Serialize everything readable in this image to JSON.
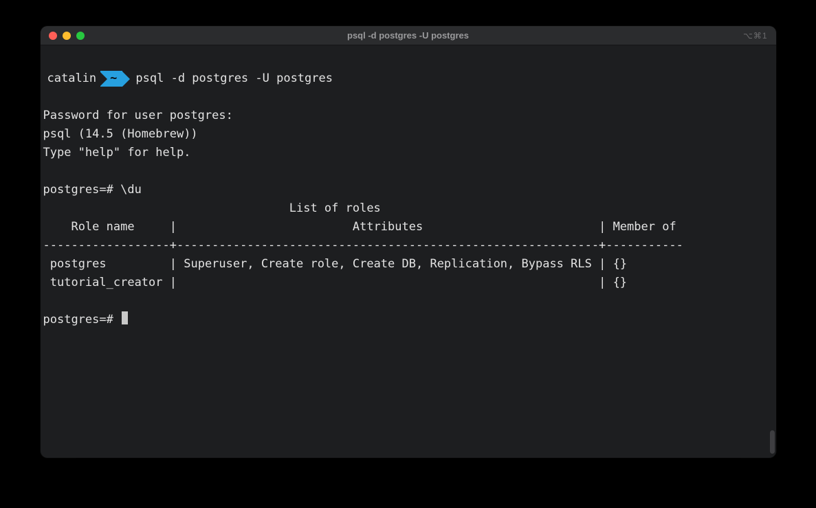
{
  "window": {
    "title": "psql -d postgres -U postgres",
    "right_indicator": "⌥⌘1"
  },
  "prompt": {
    "user": "catalin",
    "cwd": "~",
    "command": "psql -d postgres -U postgres"
  },
  "session": {
    "password_prompt": "Password for user postgres:",
    "version_line": "psql (14.5 (Homebrew))",
    "help_line": "Type \"help\" for help."
  },
  "psql": {
    "prompt": "postgres=#",
    "command": "\\du",
    "table": {
      "title": "List of roles",
      "headers": [
        "Role name",
        "Attributes",
        "Member of"
      ],
      "rows": [
        {
          "role": "postgres",
          "attributes": "Superuser, Create role, Create DB, Replication, Bypass RLS",
          "member_of": "{}"
        },
        {
          "role": "tutorial_creator",
          "attributes": "",
          "member_of": "{}"
        }
      ]
    }
  }
}
